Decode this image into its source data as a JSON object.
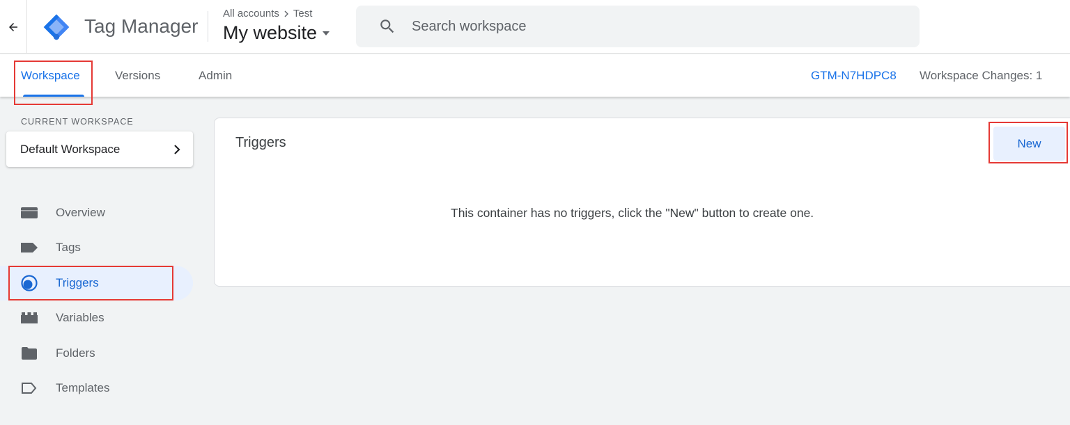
{
  "header": {
    "app_name": "Tag Manager",
    "breadcrumb": {
      "account": "All accounts",
      "container_account": "Test"
    },
    "container_name": "My website",
    "search": {
      "placeholder": "Search workspace",
      "value": ""
    }
  },
  "nav": {
    "tabs": [
      {
        "label": "Workspace",
        "active": true
      },
      {
        "label": "Versions",
        "active": false
      },
      {
        "label": "Admin",
        "active": false
      }
    ],
    "container_id": "GTM-N7HDPC8",
    "workspace_changes": "Workspace Changes: 1"
  },
  "sidebar": {
    "current_workspace_label": "CURRENT WORKSPACE",
    "workspace_name": "Default Workspace",
    "items": [
      {
        "label": "Overview",
        "icon": "overview-icon",
        "active": false
      },
      {
        "label": "Tags",
        "icon": "tag-icon",
        "active": false
      },
      {
        "label": "Triggers",
        "icon": "trigger-icon",
        "active": true
      },
      {
        "label": "Variables",
        "icon": "variables-icon",
        "active": false
      },
      {
        "label": "Folders",
        "icon": "folder-icon",
        "active": false
      },
      {
        "label": "Templates",
        "icon": "template-icon",
        "active": false
      }
    ]
  },
  "main": {
    "title": "Triggers",
    "new_button_label": "New",
    "empty_message": "This container has no triggers, click the \"New\" button to create one."
  },
  "colors": {
    "accent_blue": "#1a73e8",
    "highlight_red": "#e53935",
    "active_bg": "#e8f0fe"
  }
}
